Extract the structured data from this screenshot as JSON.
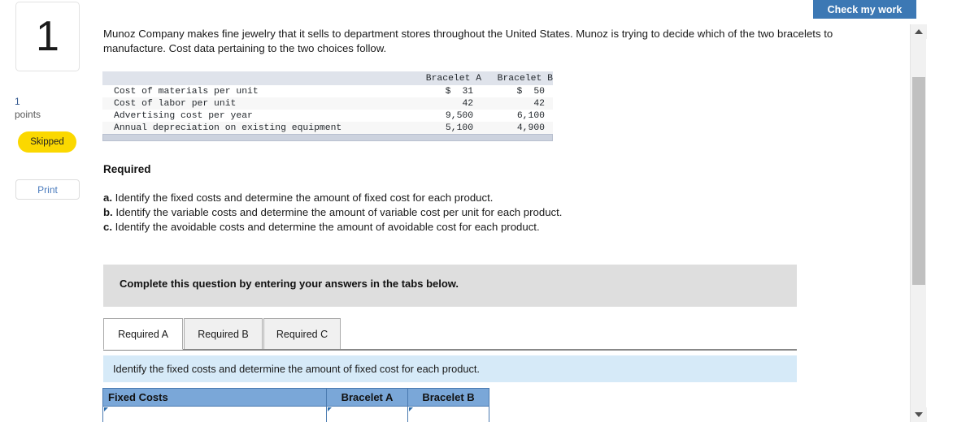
{
  "toolbar": {
    "check_my_work_label": "Check my work"
  },
  "sidebar": {
    "question_number": "1",
    "points_value": "1",
    "points_label": "points",
    "status_badge": "Skipped",
    "print_label": "Print",
    "badge_color": "#fbd800"
  },
  "main": {
    "intro_paragraph": "Munoz Company makes fine jewelry that it sells to department stores throughout the United States. Munoz is trying to decide which of the two bracelets to manufacture. Cost data pertaining to the two choices follow.",
    "required_heading": "Required",
    "requirements": [
      {
        "letter": "a.",
        "text": " Identify the fixed costs and determine the amount of fixed cost for each product."
      },
      {
        "letter": "b.",
        "text": " Identify the variable costs and determine the amount of variable cost per unit for each product."
      },
      {
        "letter": "c.",
        "text": " Identify the avoidable costs and determine the amount of avoidable cost for each product."
      }
    ],
    "complete_banner": "Complete this question by entering your answers in the tabs below.",
    "instruction": "Identify the fixed costs and determine the amount of fixed cost for each product."
  },
  "cost_table": {
    "headers": [
      "",
      "Bracelet A",
      "Bracelet B"
    ],
    "rows": [
      {
        "label": "Cost of materials per unit",
        "a_currency": "$",
        "a_value": "31",
        "b_currency": "$",
        "b_value": "50"
      },
      {
        "label": "Cost of labor per unit",
        "a_currency": "",
        "a_value": "42",
        "b_currency": "",
        "b_value": "42"
      },
      {
        "label": "Advertising cost per year",
        "a_currency": "",
        "a_value": "9,500",
        "b_currency": "",
        "b_value": "6,100"
      },
      {
        "label": "Annual depreciation on existing equipment",
        "a_currency": "",
        "a_value": "5,100",
        "b_currency": "",
        "b_value": "4,900"
      }
    ]
  },
  "tabs": [
    {
      "label": "Required A",
      "active": true
    },
    {
      "label": "Required B",
      "active": false
    },
    {
      "label": "Required C",
      "active": false
    }
  ],
  "answer_table": {
    "headers": [
      "Fixed Costs",
      "Bracelet A",
      "Bracelet B"
    ],
    "rows": [
      {
        "label": "",
        "a": "",
        "b": ""
      }
    ],
    "header_color": "#7aa7d8"
  },
  "scrollbar": {
    "up_icon": "triangle-up-icon",
    "down_icon": "triangle-down-icon"
  }
}
